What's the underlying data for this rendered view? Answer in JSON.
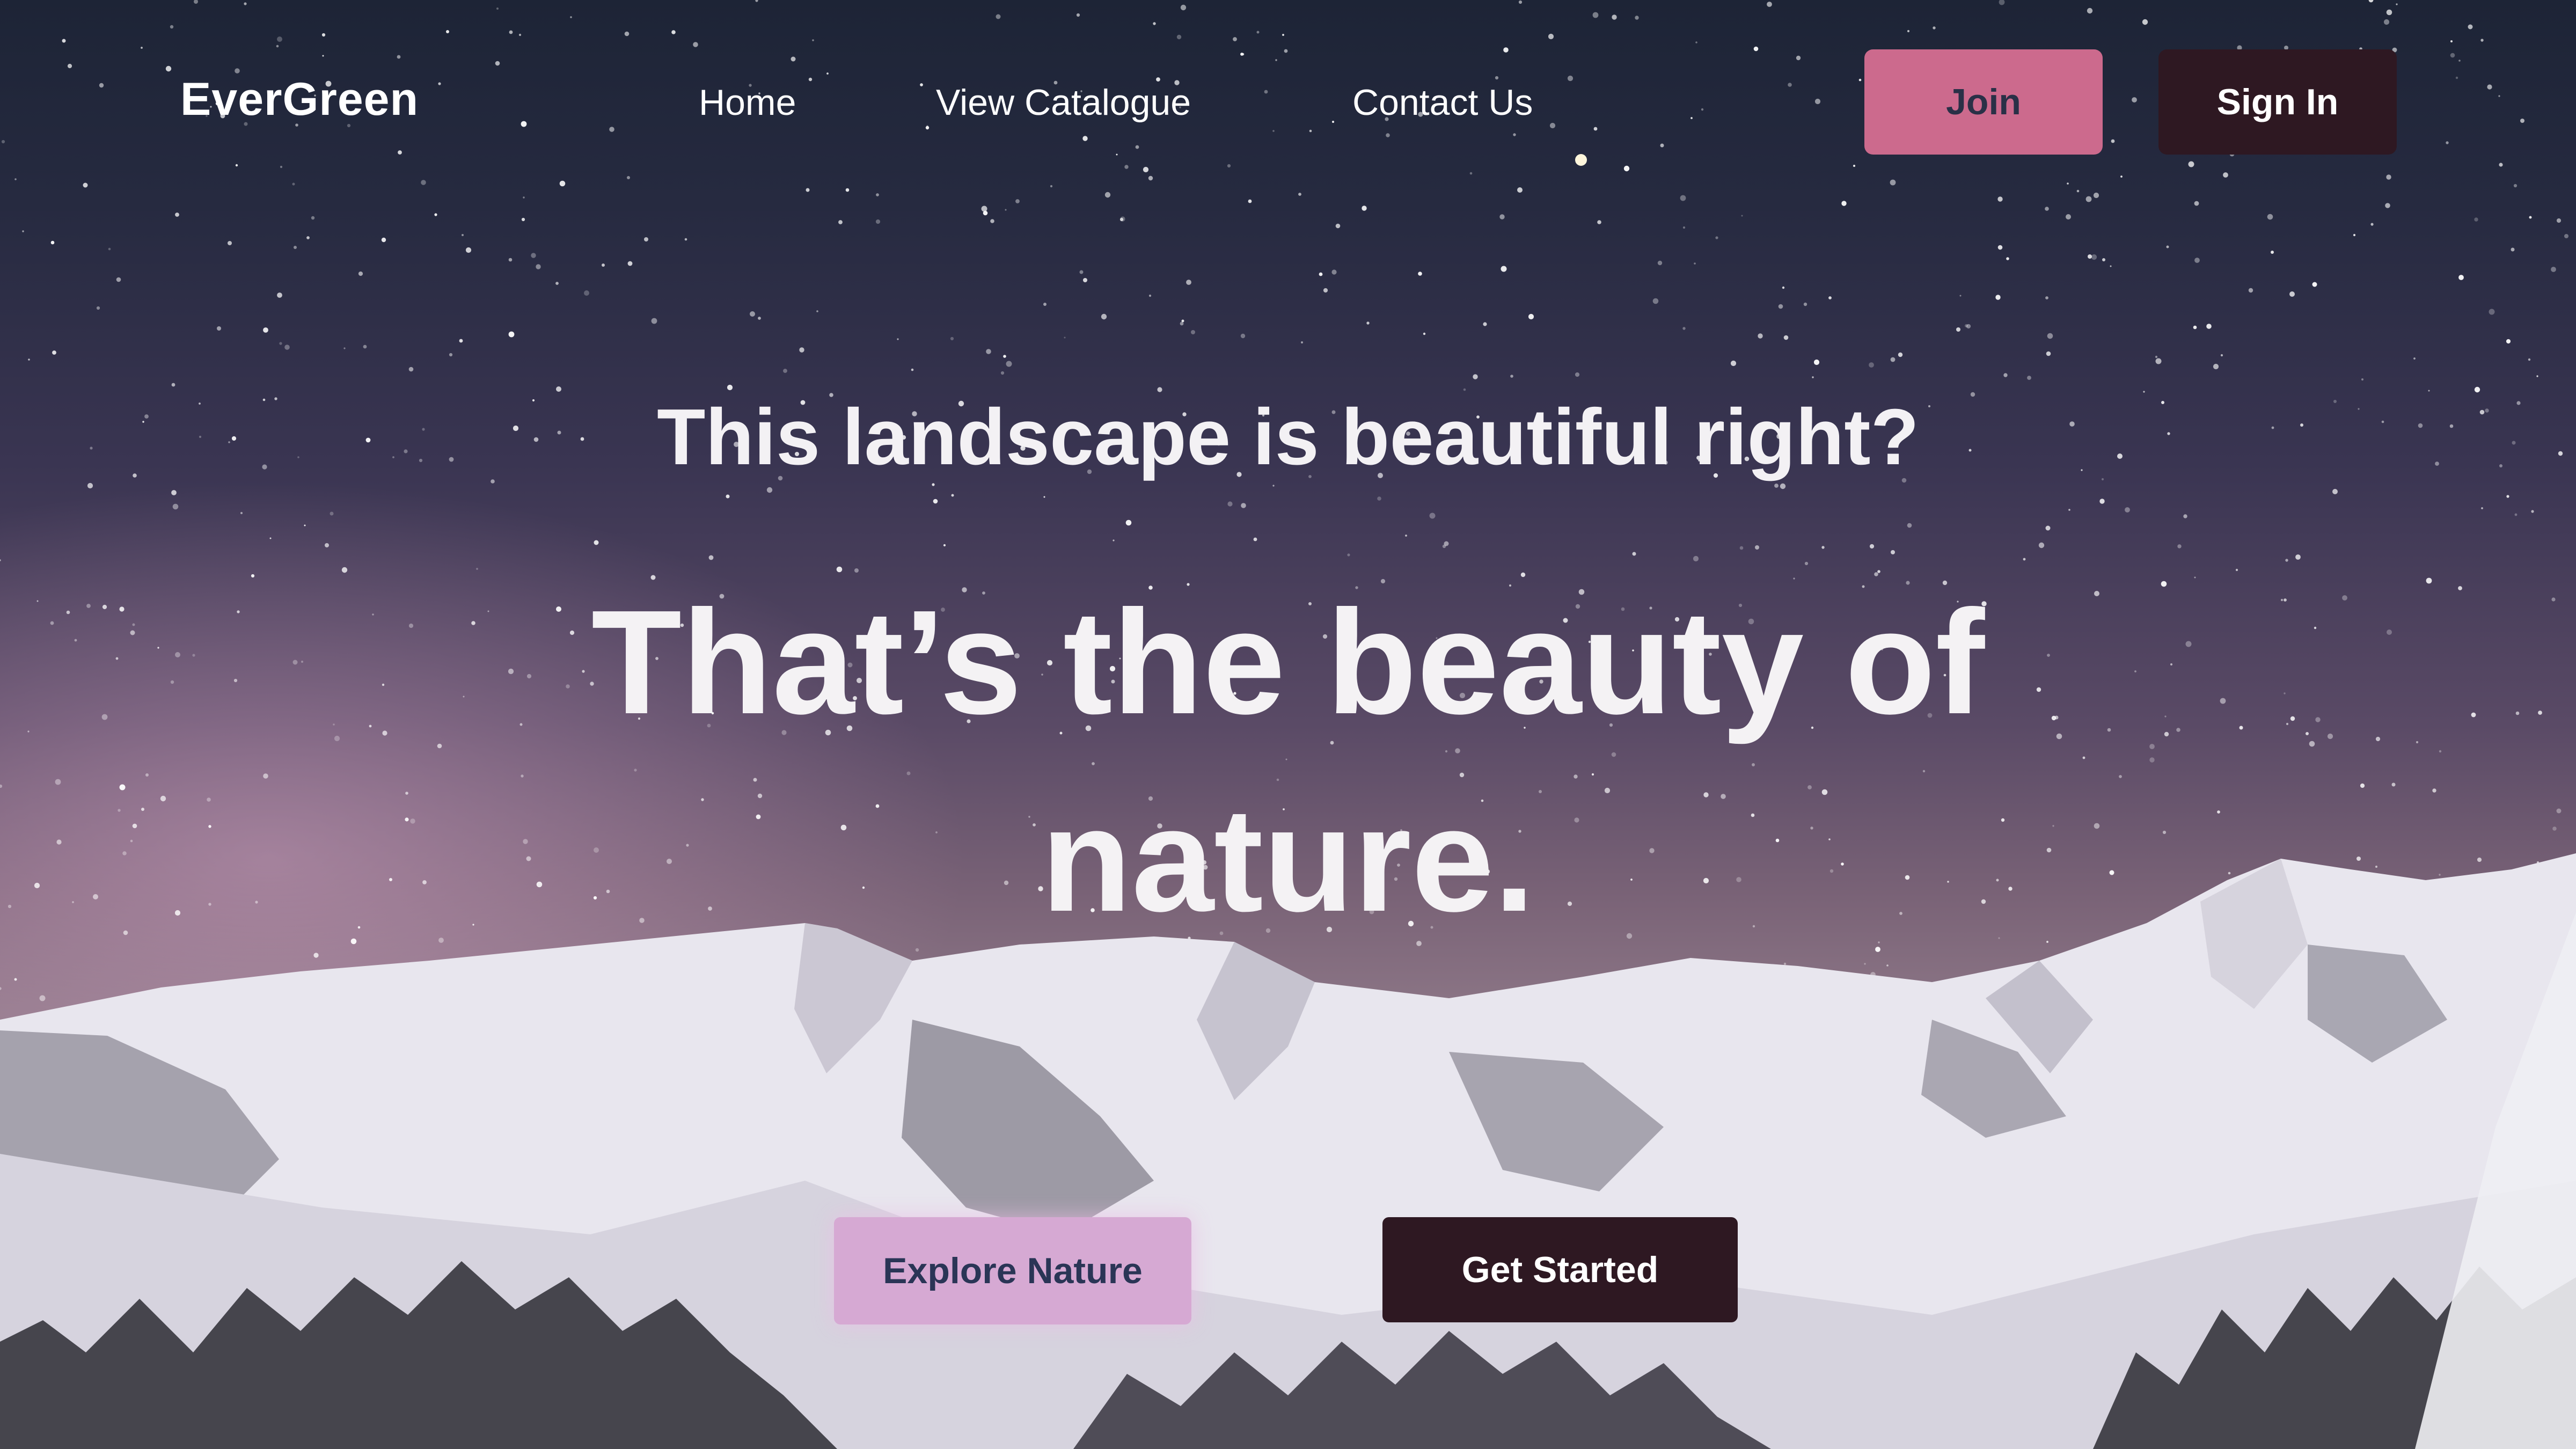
{
  "brand": {
    "name": "EverGreen"
  },
  "nav": {
    "links": [
      {
        "label": "Home"
      },
      {
        "label": "View Catalogue"
      },
      {
        "label": "Contact Us"
      }
    ],
    "join_label": "Join",
    "signin_label": "Sign In"
  },
  "hero": {
    "kicker": "This landscape is beautiful right?",
    "headline": "That’s the beauty of nature.",
    "explore_label": "Explore Nature",
    "get_started_label": "Get Started"
  },
  "colors": {
    "join_button": "#cc6a8d",
    "dark_button": "#2e1822",
    "explore_button": "#d6a9d3"
  }
}
